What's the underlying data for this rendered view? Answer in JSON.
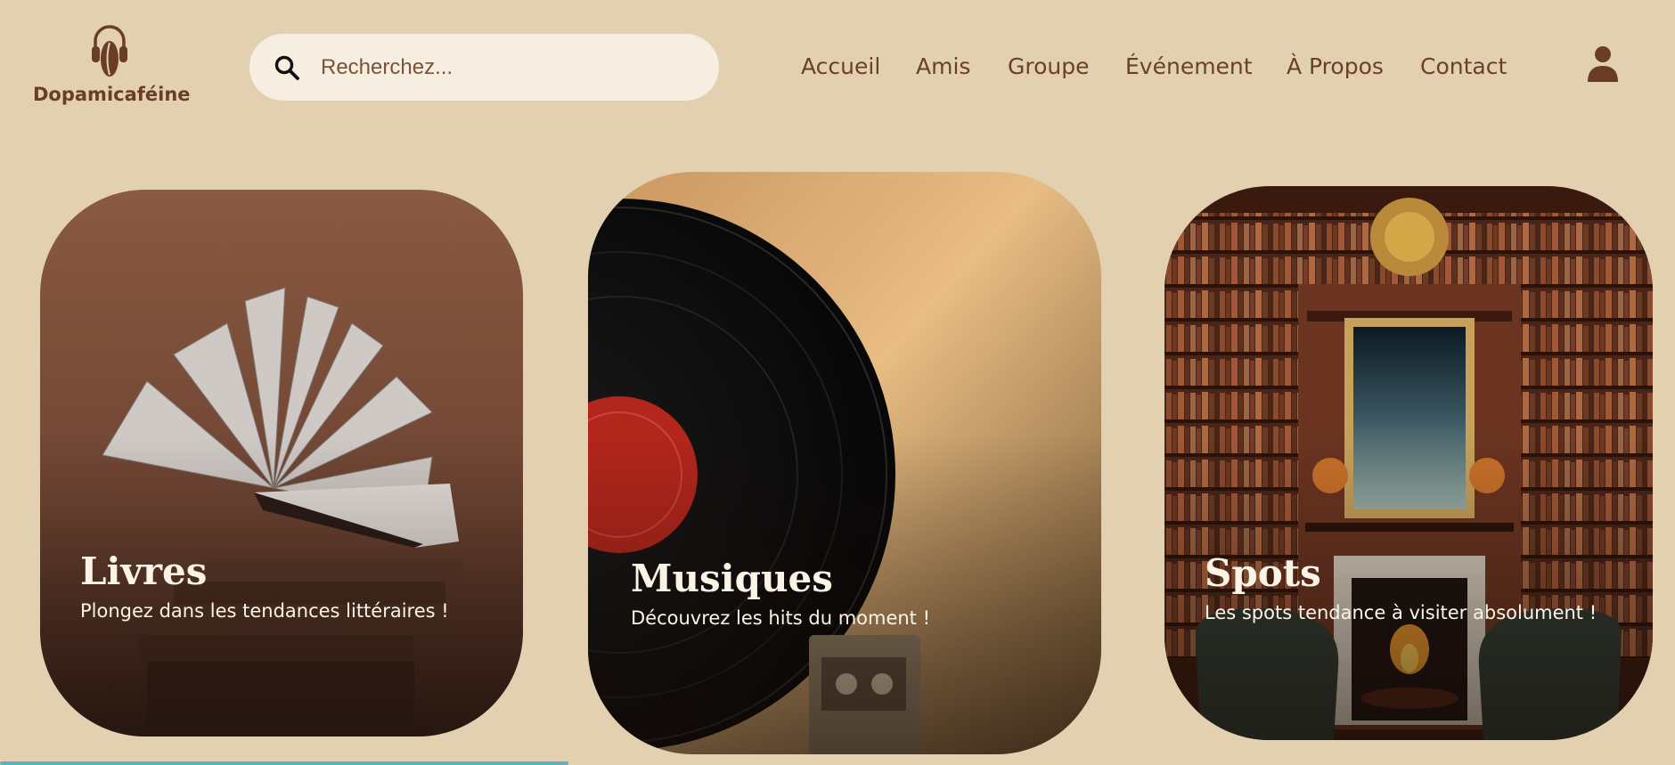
{
  "brand": {
    "name": "Dopamicaféine",
    "logo_icon": "headphones-coffee-bean-icon"
  },
  "search": {
    "placeholder": "Recherchez...",
    "value": "",
    "icon": "search-icon"
  },
  "nav": {
    "items": [
      "Accueil",
      "Amis",
      "Groupe",
      "Événement",
      "À Propos",
      "Contact"
    ]
  },
  "user": {
    "icon": "user-icon"
  },
  "cards": [
    {
      "title": "Livres",
      "text": "Plongez dans les tendances littéraires !",
      "image": "flying-book-photo"
    },
    {
      "title": "Musiques",
      "text": "Découvrez les hits du moment !",
      "image": "vinyl-record-photo"
    },
    {
      "title": "Spots",
      "text": "Les spots tendance à visiter absolument !",
      "image": "library-fireplace-photo"
    }
  ],
  "colors": {
    "background": "#e2d0b1",
    "brand_brown": "#6a3e26",
    "search_bg": "#f6eee1",
    "card_text": "#fbf4e6",
    "scroll_accent": "#5db3c6"
  }
}
